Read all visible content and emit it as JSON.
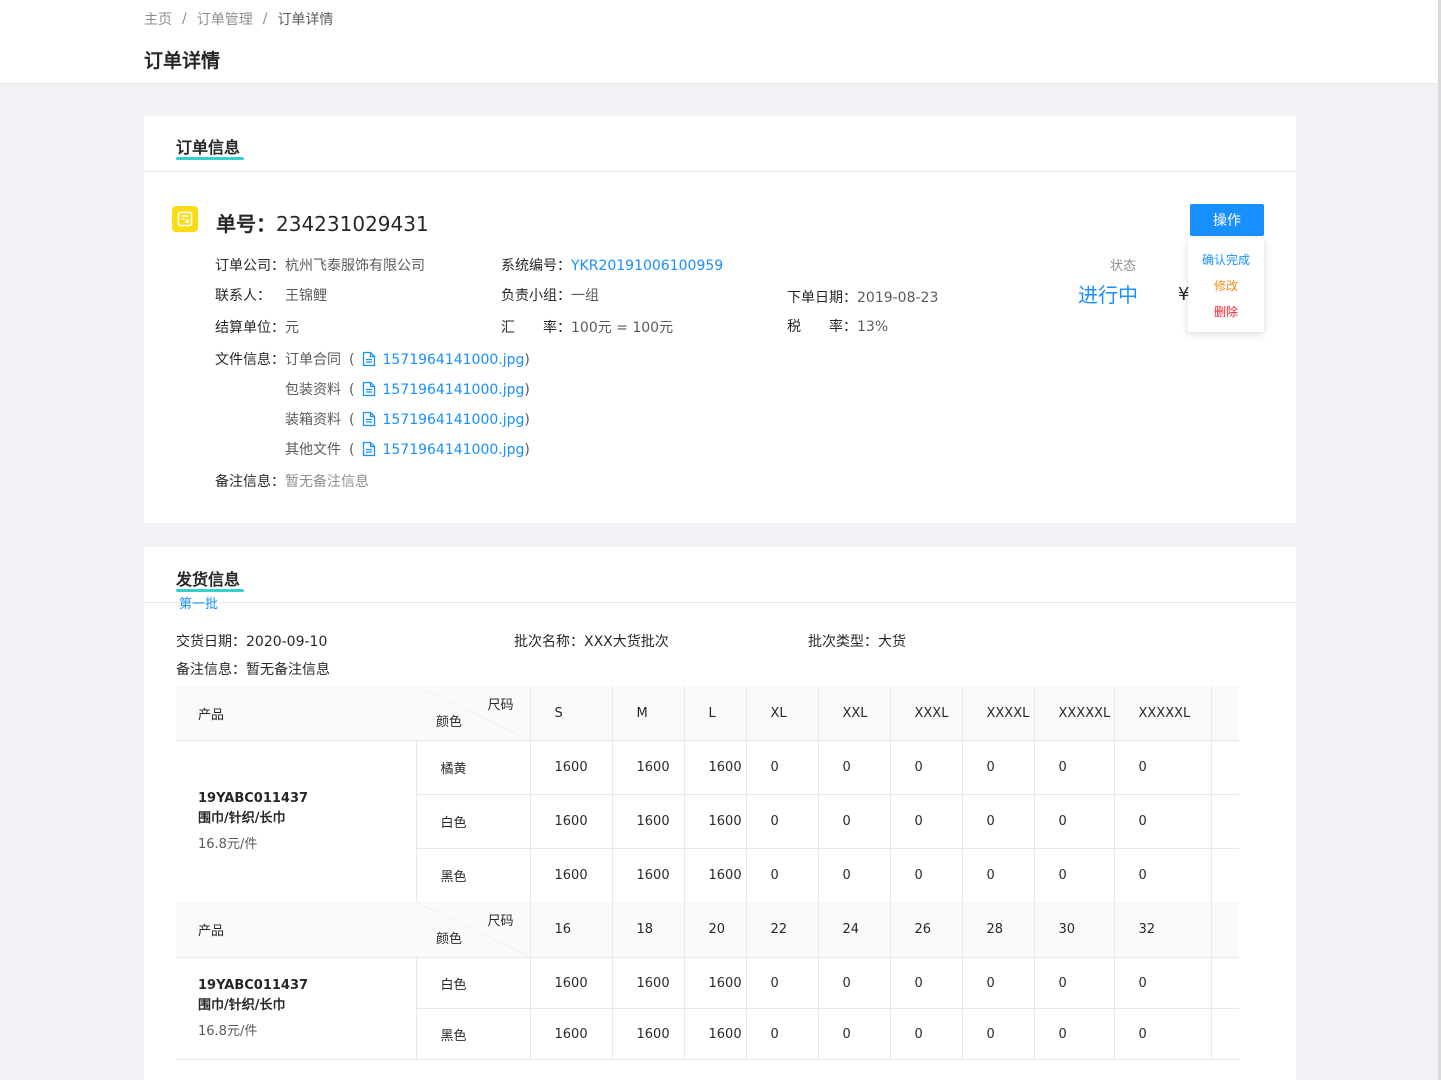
{
  "breadcrumb": {
    "home": "主页",
    "orders": "订单管理",
    "current": "订单详情",
    "sep": "/"
  },
  "page_title": "订单详情",
  "order_card": {
    "title": "订单信息",
    "order_no_label": "单号：",
    "order_no": "234231029431",
    "op_button": "操作",
    "op_menu": {
      "confirm": "确认完成",
      "edit": "修改",
      "delete": "删除"
    },
    "company_label": "订单公司：",
    "company": "杭州飞泰服饰有限公司",
    "sys_no_label": "系统编号：",
    "sys_no": "YKR2019100610095​9",
    "contact_label": "联系人：",
    "contact": "王锦鲤",
    "group_label": "负责小组：",
    "group": "一组",
    "order_date_label": "下单日期：",
    "order_date": "2019-08-23",
    "unit_label": "结算单位：",
    "unit": "元",
    "rate_label": "汇　　率：",
    "rate": "100元 = 100元",
    "tax_label": "税　　率：",
    "tax": "13%",
    "status_label": "状态",
    "status": "进行中",
    "currency": "¥",
    "files_label": "文件信息：",
    "files": [
      {
        "type": "订单合同",
        "name": "1571964141000.jpg"
      },
      {
        "type": "包装资料",
        "name": "1571964141000.jpg"
      },
      {
        "type": "装箱资料",
        "name": "1571964141000.jpg"
      },
      {
        "type": "其他文件",
        "name": "1571964141000.jpg"
      }
    ],
    "remark_label": "备注信息：",
    "remark": "暂无备注信息",
    "colors": {
      "accent": "#1890ff",
      "edit": "#fa8c16",
      "delete": "#f5222d",
      "icon": "#fadb14"
    }
  },
  "ship_card": {
    "title": "发货信息",
    "batch_tab": "第一批",
    "delivery_label": "交货日期：",
    "delivery": "2020-09-10",
    "batch_name_label": "批次名称：",
    "batch_name": "XXX大货批次",
    "batch_type_label": "批次类型：",
    "batch_type": "大货",
    "remark_label": "备注信息：",
    "remark": "暂无备注信息",
    "table1": {
      "product_header": "产品",
      "size_header": "尺码",
      "color_header": "颜色",
      "sizes": [
        "S",
        "M",
        "L",
        "XL",
        "XXL",
        "XXXL",
        "XXXXL",
        "XXXXXL",
        "XXXXXL"
      ],
      "product": {
        "code": "19YABC011437",
        "name": "围巾/针织/长巾",
        "price": "16.8元/件"
      },
      "rows": [
        {
          "color": "橘黄",
          "values": [
            "1600",
            "1600",
            "1600",
            "0",
            "0",
            "0",
            "0",
            "0",
            "0"
          ]
        },
        {
          "color": "白色",
          "values": [
            "1600",
            "1600",
            "1600",
            "0",
            "0",
            "0",
            "0",
            "0",
            "0"
          ]
        },
        {
          "color": "黑色",
          "values": [
            "1600",
            "1600",
            "1600",
            "0",
            "0",
            "0",
            "0",
            "0",
            "0"
          ]
        }
      ]
    },
    "table2": {
      "product_header": "产品",
      "size_header": "尺码",
      "color_header": "颜色",
      "sizes": [
        "16",
        "18",
        "20",
        "22",
        "24",
        "26",
        "28",
        "30",
        "32"
      ],
      "product": {
        "code": "19YABC011437",
        "name": "围巾/针织/长巾",
        "price": "16.8元/件"
      },
      "rows": [
        {
          "color": "白色",
          "values": [
            "1600",
            "1600",
            "1600",
            "0",
            "0",
            "0",
            "0",
            "0",
            "0"
          ]
        },
        {
          "color": "黑色",
          "values": [
            "1600",
            "1600",
            "1600",
            "0",
            "0",
            "0",
            "0",
            "0",
            "0"
          ]
        }
      ]
    }
  }
}
